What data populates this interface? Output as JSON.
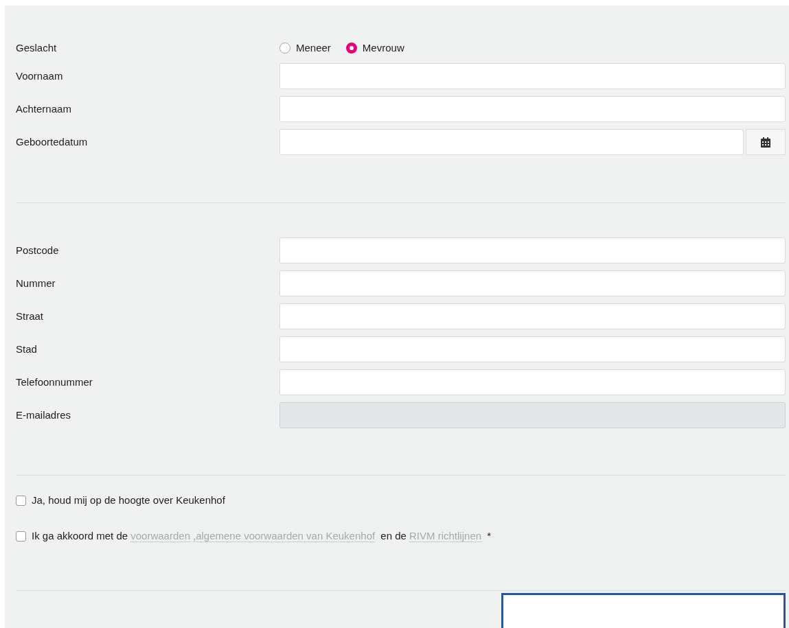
{
  "gender": {
    "label": "Geslacht",
    "options": [
      {
        "label": "Meneer",
        "selected": false
      },
      {
        "label": "Mevrouw",
        "selected": true
      }
    ]
  },
  "personal_fields": [
    {
      "label": "Voornaam",
      "kind": "text",
      "disabled": false
    },
    {
      "label": "Achternaam",
      "kind": "text",
      "disabled": false
    },
    {
      "label": "Geboortedatum",
      "kind": "date",
      "disabled": false
    }
  ],
  "address_fields": [
    {
      "label": "Postcode",
      "kind": "text",
      "disabled": false
    },
    {
      "label": "Nummer",
      "kind": "text",
      "disabled": false
    },
    {
      "label": "Straat",
      "kind": "text",
      "disabled": false
    },
    {
      "label": "Stad",
      "kind": "text",
      "disabled": false
    },
    {
      "label": "Telefoonnummer",
      "kind": "text",
      "disabled": false
    },
    {
      "label": "E-mailadres",
      "kind": "text",
      "disabled": true
    }
  ],
  "checkboxes": [
    {
      "checked": false,
      "parts": [
        {
          "kind": "text",
          "text": "Ja, houd mij op de hoogte over Keukenhof"
        }
      ]
    },
    {
      "checked": false,
      "parts": [
        {
          "kind": "text",
          "text": "Ik ga akkoord met de "
        },
        {
          "kind": "link",
          "text": "voorwaarden"
        },
        {
          "kind": "link",
          "text": ",algemene voorwaarden van Keukenhof"
        },
        {
          "kind": "text",
          "text": " en de "
        },
        {
          "kind": "link",
          "text": "RIVM richtlijnen"
        },
        {
          "kind": "text",
          "text": " *"
        }
      ]
    }
  ]
}
